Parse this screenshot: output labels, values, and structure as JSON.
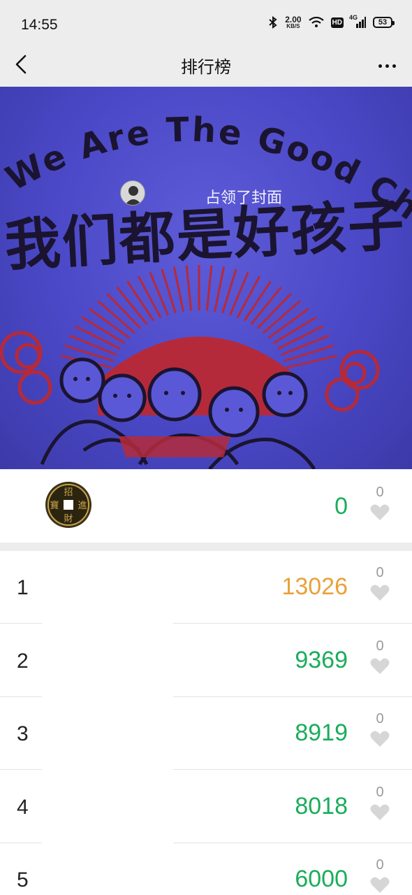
{
  "status_bar": {
    "time": "14:55",
    "net_speed_value": "2.00",
    "net_speed_unit": "KB/S",
    "hd_label": "HD",
    "network_label": "4G",
    "battery_level": "53",
    "icons": [
      "bluetooth-icon",
      "wifi-icon",
      "signal-icon",
      "battery-icon"
    ]
  },
  "nav": {
    "title": "排行榜",
    "back_icon": "chevron-left-icon",
    "more_icon": "more-dots-icon"
  },
  "cover": {
    "caption": "占领了封面",
    "english_text": "We Are The Good Children",
    "chinese_text": "我们都是好孩子",
    "colors": {
      "background": "#4a48c6",
      "ink": "#1a1430",
      "sun": "#b52a3a"
    }
  },
  "my_rank": {
    "steps": "0",
    "likes": "0",
    "avatar_icon": "coin-avatar-icon"
  },
  "ranking": [
    {
      "rank": "1",
      "steps": "13026",
      "likes": "0",
      "steps_color": "orange"
    },
    {
      "rank": "2",
      "steps": "9369",
      "likes": "0",
      "steps_color": "green"
    },
    {
      "rank": "3",
      "steps": "8919",
      "likes": "0",
      "steps_color": "green"
    },
    {
      "rank": "4",
      "steps": "8018",
      "likes": "0",
      "steps_color": "green"
    },
    {
      "rank": "5",
      "steps": "6000",
      "likes": "0",
      "steps_color": "green"
    }
  ],
  "colors": {
    "accent_green": "#1aad5a",
    "accent_orange": "#e8a23a",
    "like_gray": "#d6d6d6",
    "bar_gray": "#ededed"
  }
}
